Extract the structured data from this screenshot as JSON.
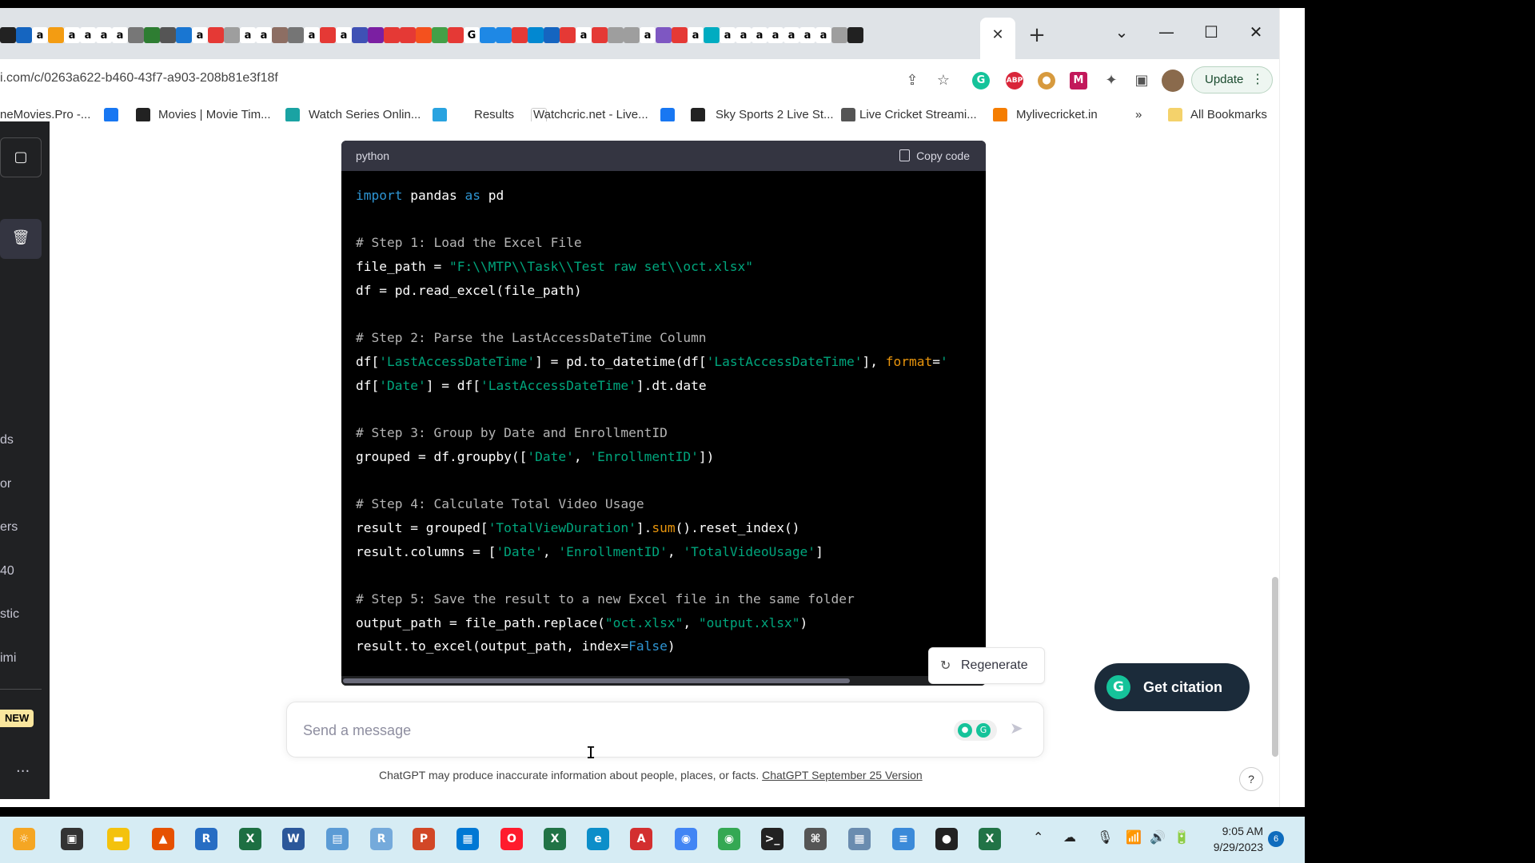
{
  "browser": {
    "active_tab_close": "✕",
    "new_tab": "+",
    "url": "i.com/c/0263a622-b460-43f7-a903-208b81e3f18f",
    "update_label": "Update",
    "update_menu": "⋮"
  },
  "bookmarks": [
    {
      "label": "neMovies.Pro -...",
      "icon": "movies-icon",
      "color": "#ffffff"
    },
    {
      "label": "",
      "icon": "facebook-icon",
      "color": "#1877f2"
    },
    {
      "label": "Movies | Movie Tim...",
      "icon": "movie-times-icon",
      "color": "#222222"
    },
    {
      "label": "Watch Series Onlin...",
      "icon": "series-icon",
      "color": "#1aa3a3"
    },
    {
      "label": "Results",
      "icon": "results-icon",
      "color": "#29a3e0"
    },
    {
      "label": "Watchcric.net - Live...",
      "icon": "watchcric-icon",
      "color": "#ffffff"
    },
    {
      "label": "",
      "icon": "facebook-circle-icon",
      "color": "#1877f2"
    },
    {
      "label": "Sky Sports 2 Live St...",
      "icon": "sky-sports-icon",
      "color": "#222222"
    },
    {
      "label": "Live Cricket Streami...",
      "icon": "globe-icon",
      "color": "#555555"
    },
    {
      "label": "Mylivecricket.in",
      "icon": "blogger-icon",
      "color": "#f57d00"
    }
  ],
  "bookmarks_overflow": "»",
  "all_bookmarks": "All Bookmarks",
  "sidebar": {
    "toggle_icon": "▢",
    "trash_icon": "🗑",
    "truncated_items": [
      "ds",
      "or",
      "ers",
      "40",
      "stic",
      "imi"
    ],
    "new_badge": "NEW",
    "more": "..."
  },
  "code_block": {
    "language": "python",
    "copy_label": "Copy code"
  },
  "regenerate_label": "Regenerate",
  "citation_label": "Get citation",
  "composer": {
    "placeholder": "Send a message"
  },
  "disclaimer": {
    "text": "ChatGPT may produce inaccurate information about people, places, or facts. ",
    "link": "ChatGPT September 25 Version"
  },
  "help": "?",
  "taskbar": {
    "time": "9:05 AM",
    "date": "9/29/2023",
    "notifications": "6"
  }
}
